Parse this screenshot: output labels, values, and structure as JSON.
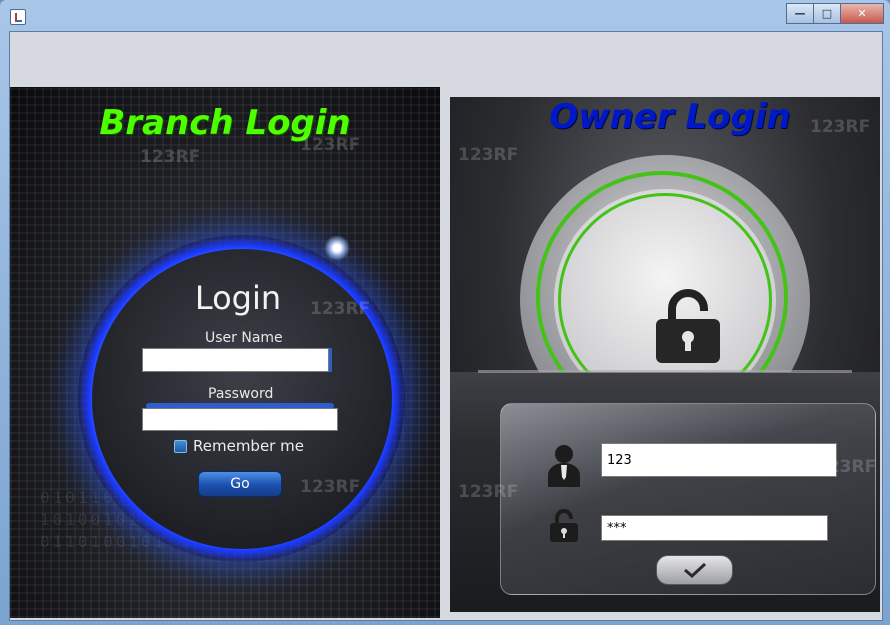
{
  "window": {
    "icon": "java-cup-icon",
    "controls": [
      "minimize",
      "maximize",
      "close"
    ]
  },
  "branch": {
    "title": "Branch Login",
    "title_color": "#4eff00",
    "heading": "Login",
    "username_label": "User Name",
    "username_value": "",
    "password_label": "Password",
    "password_value": "",
    "remember_label": "Remember me",
    "go_label": "Go",
    "glow_color": "#2f56ff"
  },
  "owner": {
    "title": "Owner Login",
    "title_color": "#0018c8",
    "username_value": "123",
    "password_value": "***",
    "ring_color": "#45c21a"
  },
  "watermarks": [
    "123RF",
    "123RF",
    "123RF",
    "123RF",
    "123RF",
    "123RF",
    "123RF",
    "123RF"
  ]
}
